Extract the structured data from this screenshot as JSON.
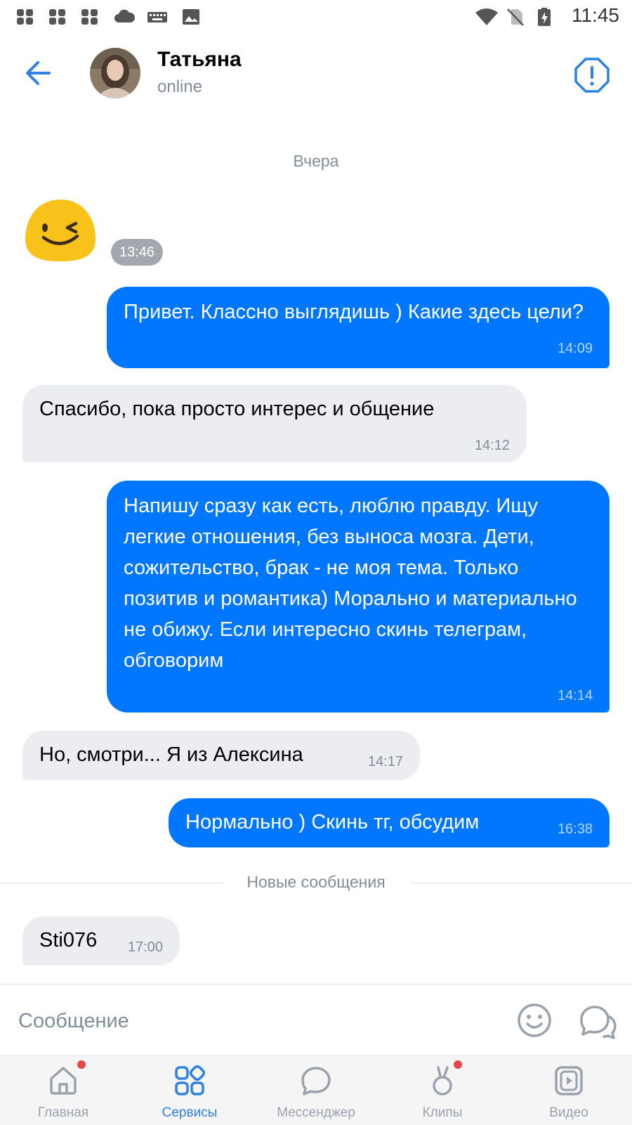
{
  "status_bar": {
    "time": "11:45"
  },
  "header": {
    "name": "Татьяна",
    "status": "online"
  },
  "date_separator": "Вчера",
  "sticker": {
    "time": "13:46"
  },
  "messages": [
    {
      "dir": "out",
      "text": "Привет. Классно выглядишь ) Какие здесь цели?",
      "time": "14:09"
    },
    {
      "dir": "in",
      "text": "Спасибо, пока просто интерес и общение",
      "time": "14:12"
    },
    {
      "dir": "out",
      "text": "Напишу сразу как есть, люблю правду. Ищу легкие отношения, без выноса мозга. Дети, сожительство, брак - не моя тема. Только позитив и романтика) Морально и материально не обижу. Если интересно скинь телеграм, обговорим",
      "time": "14:14"
    },
    {
      "dir": "in",
      "text": "Но, смотри... Я из Алексина",
      "time": "14:17"
    },
    {
      "dir": "out",
      "text": "Нормально ) Скинь тг, обсудим",
      "time": "16:38"
    },
    {
      "dir": "in",
      "text": "Sti076",
      "time": "17:00"
    }
  ],
  "new_messages_label": "Новые сообщения",
  "composer": {
    "placeholder": "Сообщение"
  },
  "tabs": [
    {
      "label": "Главная",
      "icon": "home-icon",
      "active": false,
      "badge": true
    },
    {
      "label": "Сервисы",
      "icon": "services-icon",
      "active": true,
      "badge": false
    },
    {
      "label": "Мессенджер",
      "icon": "messenger-icon",
      "active": false,
      "badge": false
    },
    {
      "label": "Клипы",
      "icon": "clips-icon",
      "active": false,
      "badge": true
    },
    {
      "label": "Видео",
      "icon": "video-icon",
      "active": false,
      "badge": false
    }
  ],
  "colors": {
    "accent": "#2d81e0",
    "outgoing_bubble": "#0177ff",
    "incoming_bubble": "#ebedf0",
    "muted_text": "#818c99",
    "badge": "#e64646"
  }
}
